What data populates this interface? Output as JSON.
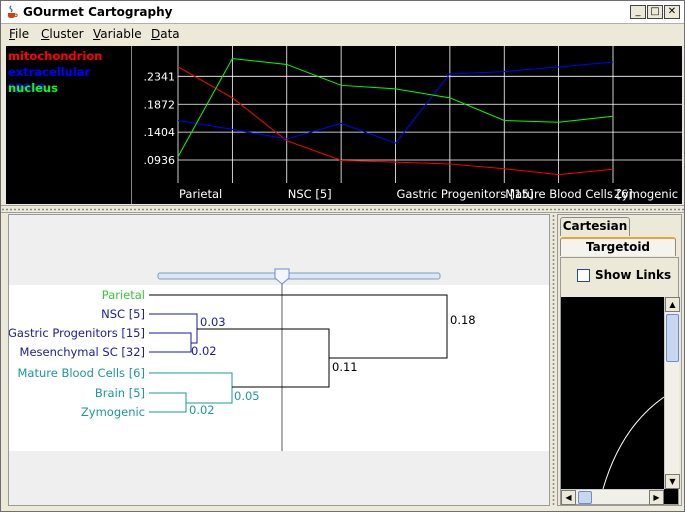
{
  "window": {
    "title": "GOurmet Cartography"
  },
  "menu": [
    {
      "label": "File",
      "mnemonic": "F",
      "rest": "ile"
    },
    {
      "label": "Cluster",
      "mnemonic": "C",
      "rest": "luster"
    },
    {
      "label": "Variable",
      "mnemonic": "V",
      "rest": "ariable"
    },
    {
      "label": "Data",
      "mnemonic": "D",
      "rest": "ata"
    }
  ],
  "legend": [
    {
      "name": "mitochondrion",
      "color": "#ff0000"
    },
    {
      "name": "extracellular space",
      "color": "#0000ff"
    },
    {
      "name": "nucleus",
      "color": "#00ff00"
    }
  ],
  "chart_data": {
    "type": "line",
    "categories": [
      "Parietal",
      "NSC [5]",
      "Gastric Progenitors [15]",
      "Mature Blood Cells [6]",
      "Zymogenic"
    ],
    "x_points": 9,
    "y_ticks": [
      ".2341",
      ".1872",
      ".1404",
      ".0936"
    ],
    "ylim": [
      0.055,
      0.285
    ],
    "grid": true,
    "series": [
      {
        "name": "mitochondrion",
        "color": "#ff0000",
        "values": [
          0.25,
          0.198,
          0.126,
          0.093,
          0.09,
          0.087,
          0.079,
          0.069,
          0.078
        ]
      },
      {
        "name": "extracellular space",
        "color": "#0000ff",
        "values": [
          0.16,
          0.145,
          0.129,
          0.155,
          0.122,
          0.238,
          0.242,
          0.25,
          0.258
        ]
      },
      {
        "name": "nucleus",
        "color": "#00ff00",
        "values": [
          0.099,
          0.264,
          0.254,
          0.219,
          0.213,
          0.198,
          0.16,
          0.157,
          0.167
        ]
      }
    ]
  },
  "dendrogram": {
    "leaves": [
      {
        "label": "Parietal",
        "color": "#33cc33"
      },
      {
        "label": "NSC [5]",
        "color": "#1a1aaa"
      },
      {
        "label": "Gastric Progenitors [15]",
        "color": "#1a1aaa"
      },
      {
        "label": "Mesenchymal SC [32]",
        "color": "#1a1aaa"
      },
      {
        "label": "Mature Blood Cells [6]",
        "color": "#1a9a9a"
      },
      {
        "label": "Brain [5]",
        "color": "#1a9a9a"
      },
      {
        "label": "Zymogenic",
        "color": "#1a9a9a"
      }
    ],
    "merges": [
      {
        "label": "0.02",
        "color": "#1a1aaa"
      },
      {
        "label": "0.03",
        "color": "#1a1aaa"
      },
      {
        "label": "0.02",
        "color": "#1a9a9a"
      },
      {
        "label": "0.05",
        "color": "#1a9a9a"
      },
      {
        "label": "0.11",
        "color": "#000000"
      },
      {
        "label": "0.18",
        "color": "#000000"
      }
    ]
  },
  "right_panel": {
    "tabs": [
      "Cartesian",
      "Targetoid"
    ],
    "active_tab": "Targetoid",
    "show_links_label": "Show Links",
    "show_links_checked": false
  }
}
